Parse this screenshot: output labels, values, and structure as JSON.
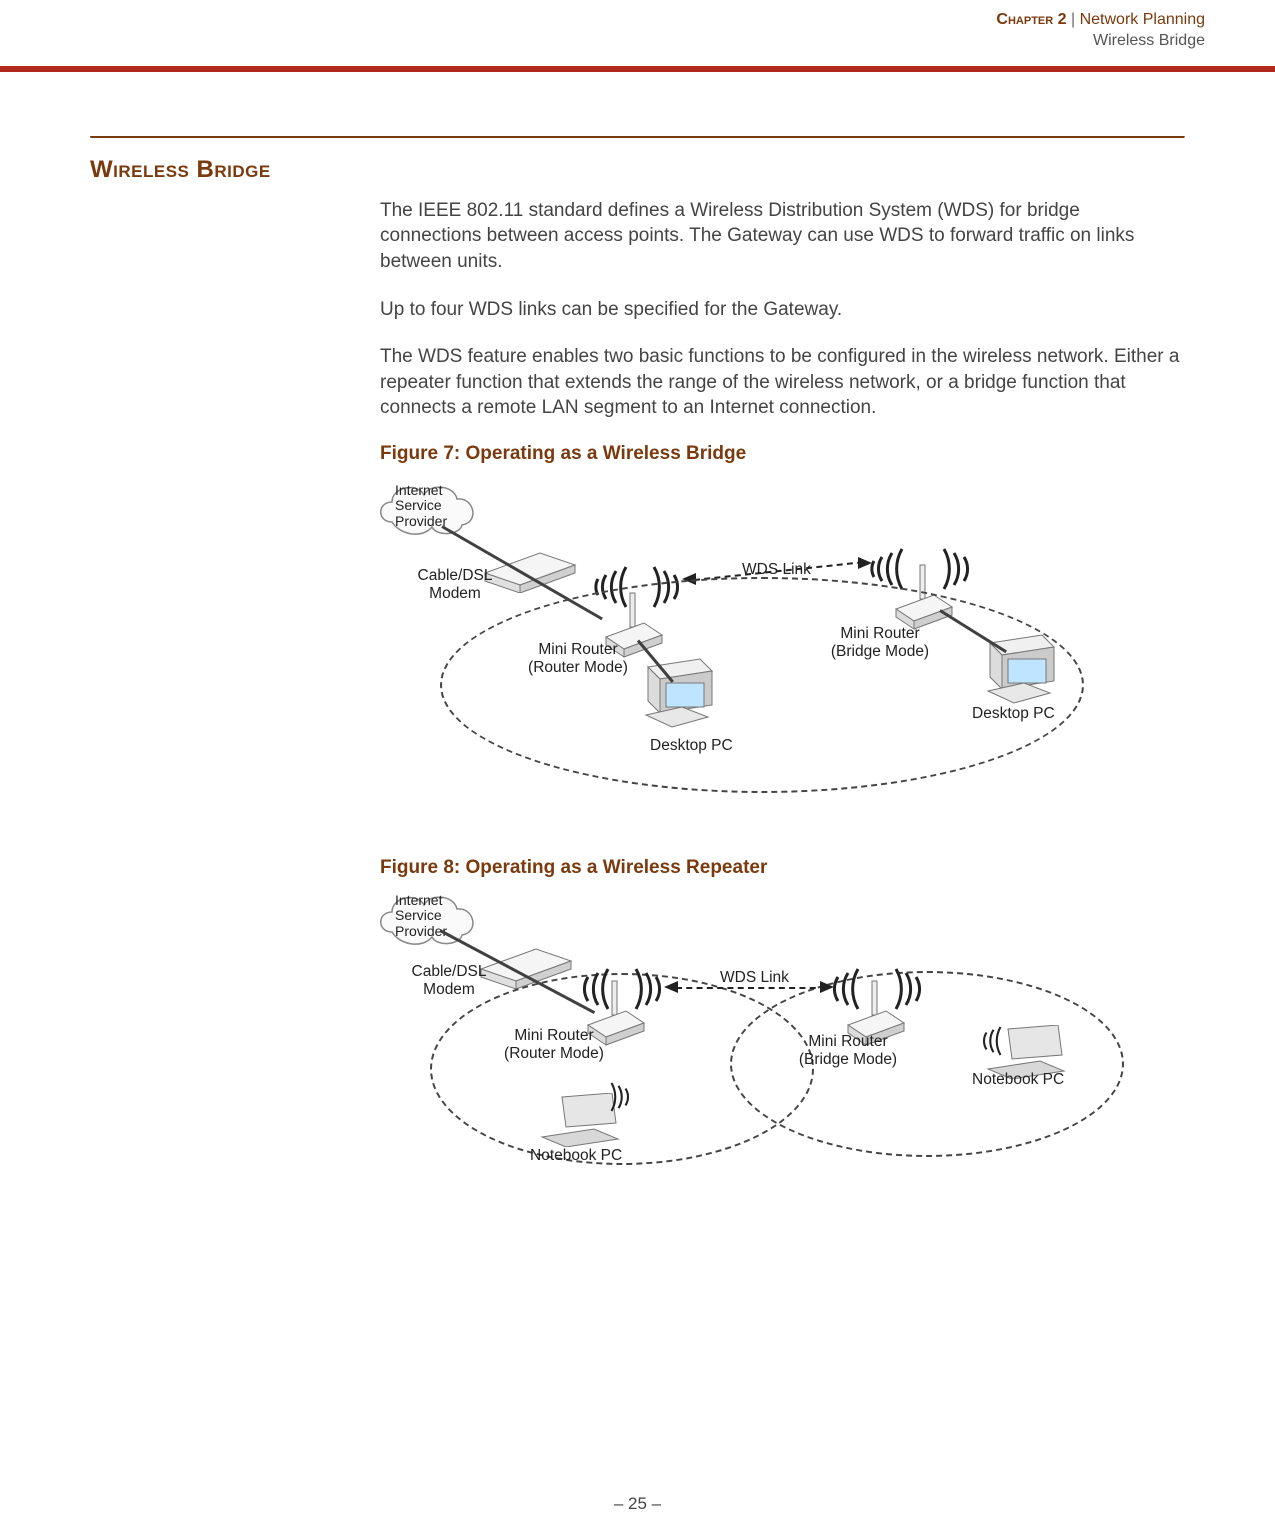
{
  "header": {
    "chapter_label": "Chapter 2",
    "separator": "  |  ",
    "chapter_title": "Network Planning",
    "subtitle": "Wireless Bridge"
  },
  "section_title": "Wireless Bridge",
  "paragraphs": {
    "p1": "The IEEE 802.11 standard defines a Wireless Distribution System (WDS) for bridge connections between access points. The Gateway can use WDS to forward traffic on links between units.",
    "p2": "Up to four WDS links can be specified for the Gateway.",
    "p3": "The WDS feature enables two basic functions to be configured in the wireless network. Either a repeater function that extends the range of the wireless network, or a bridge function that connects a remote LAN segment to an Internet connection."
  },
  "figure7": {
    "caption": "Figure 7:  Operating as a Wireless Bridge",
    "labels": {
      "isp": "Internet\nService\nProvider",
      "modem": "Cable/DSL\nModem",
      "router_mode": "Mini Router\n(Router Mode)",
      "bridge_mode": "Mini Router\n(Bridge Mode)",
      "wds_link": "WDS Link",
      "desktop_left": "Desktop PC",
      "desktop_right": "Desktop PC"
    }
  },
  "figure8": {
    "caption": "Figure 8:  Operating as a Wireless Repeater",
    "labels": {
      "isp": "Internet\nService\nProvider",
      "modem": "Cable/DSL\nModem",
      "router_mode": "Mini Router\n(Router Mode)",
      "bridge_mode": "Mini Router\n(Bridge Mode)",
      "wds_link": "WDS Link",
      "notebook_left": "Notebook PC",
      "notebook_right": "Notebook PC"
    }
  },
  "footer": {
    "page": "–  25  –"
  }
}
